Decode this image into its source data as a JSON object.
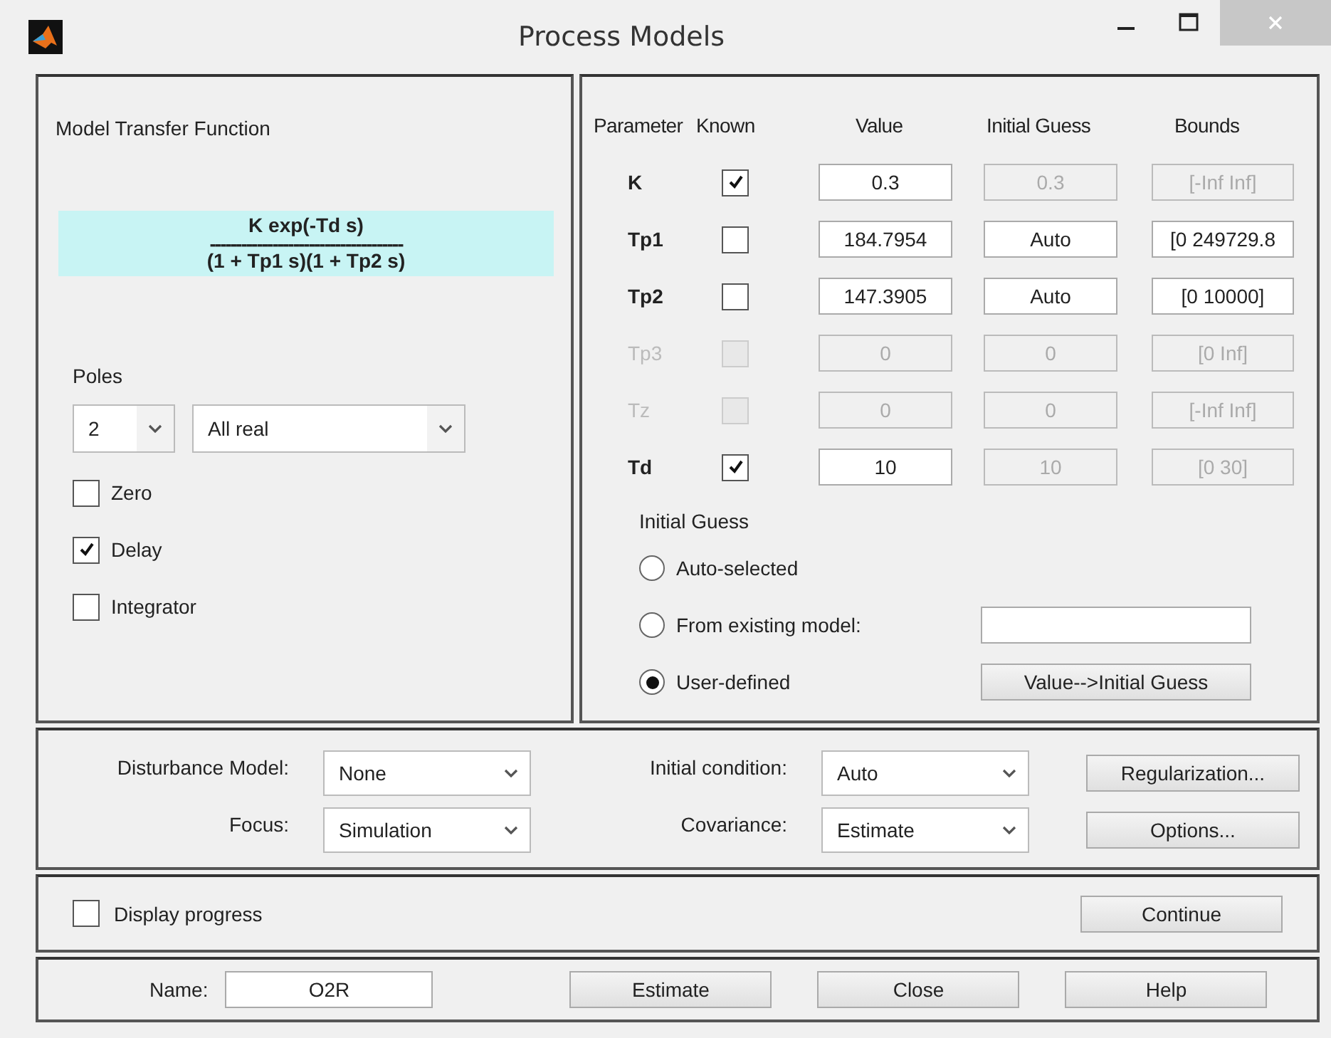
{
  "window": {
    "title": "Process Models"
  },
  "transfer_function": {
    "heading": "Model Transfer Function",
    "numerator": "K exp(-Td s)",
    "divider": "-------------------------------------",
    "denominator": "(1 + Tp1 s)(1 + Tp2 s)"
  },
  "poles": {
    "label": "Poles",
    "count": "2",
    "type": "All real"
  },
  "options": [
    {
      "label": "Zero",
      "checked": false
    },
    {
      "label": "Delay",
      "checked": true
    },
    {
      "label": "Integrator",
      "checked": false
    }
  ],
  "parameter_table": {
    "columns": [
      "Parameter",
      "Known",
      "Value",
      "Initial Guess",
      "Bounds"
    ],
    "rows": [
      {
        "name": "K",
        "disabled": false,
        "known": true,
        "value": "0.3",
        "initial_guess": {
          "text": "0.3",
          "disabled": true
        },
        "bounds": {
          "text": "[-Inf Inf]",
          "disabled": true
        }
      },
      {
        "name": "Tp1",
        "disabled": false,
        "known": false,
        "value": "184.7954",
        "initial_guess": {
          "text": "Auto",
          "disabled": false
        },
        "bounds": {
          "text": "[0 249729.8",
          "disabled": false
        }
      },
      {
        "name": "Tp2",
        "disabled": false,
        "known": false,
        "value": "147.3905",
        "initial_guess": {
          "text": "Auto",
          "disabled": false
        },
        "bounds": {
          "text": "[0 10000]",
          "disabled": false
        }
      },
      {
        "name": "Tp3",
        "disabled": true,
        "known": false,
        "value": "0",
        "initial_guess": {
          "text": "0",
          "disabled": true
        },
        "bounds": {
          "text": "[0 Inf]",
          "disabled": true
        }
      },
      {
        "name": "Tz",
        "disabled": true,
        "known": false,
        "value": "0",
        "initial_guess": {
          "text": "0",
          "disabled": true
        },
        "bounds": {
          "text": "[-Inf Inf]",
          "disabled": true
        }
      },
      {
        "name": "Td",
        "disabled": false,
        "known": true,
        "value": "10",
        "initial_guess": {
          "text": "10",
          "disabled": true
        },
        "bounds": {
          "text": "[0 30]",
          "disabled": true
        }
      }
    ]
  },
  "initial_guess": {
    "heading": "Initial Guess",
    "choices": [
      {
        "label": "Auto-selected",
        "selected": false
      },
      {
        "label": "From existing model:",
        "selected": false
      },
      {
        "label": "User-defined",
        "selected": true
      }
    ],
    "copy_button": "Value-->Initial Guess"
  },
  "settings": {
    "disturbance_model": {
      "label": "Disturbance Model:",
      "value": "None"
    },
    "focus": {
      "label": "Focus:",
      "value": "Simulation"
    },
    "initial_condition": {
      "label": "Initial condition:",
      "value": "Auto"
    },
    "covariance": {
      "label": "Covariance:",
      "value": "Estimate"
    },
    "buttons": [
      "Regularization...",
      "Options..."
    ]
  },
  "progress": {
    "label": "Display progress",
    "checked": false,
    "button": "Continue"
  },
  "footer": {
    "name_label": "Name:",
    "name_value": "O2R",
    "buttons": [
      "Estimate",
      "Close",
      "Help"
    ]
  }
}
